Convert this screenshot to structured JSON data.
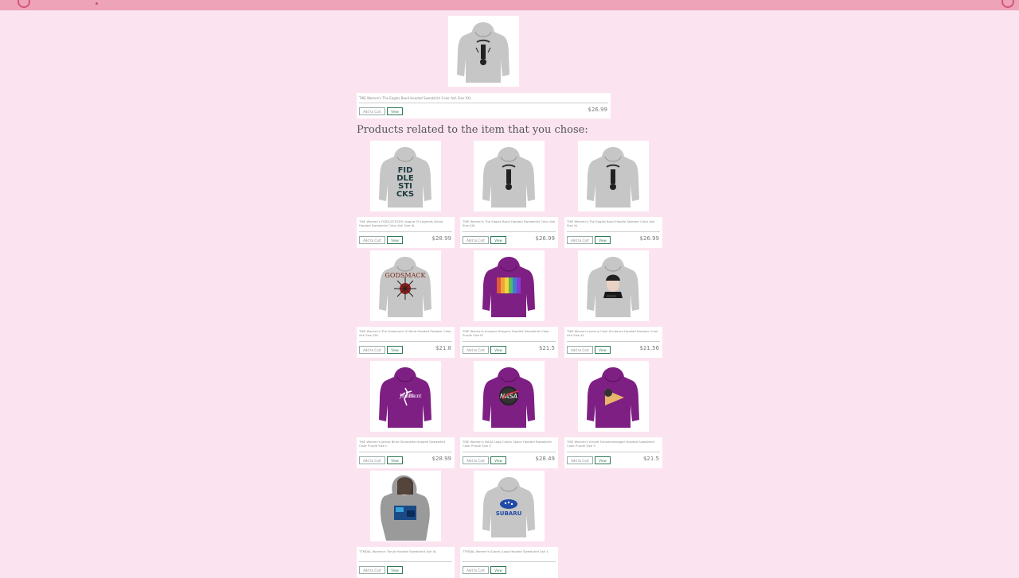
{
  "featured": {
    "image": "gray-hoodie-eagles-band",
    "title": "TIKE Women's The Eagles Band Hooded Sweatshirt Color Ash Size XXL",
    "add_label": "Add to Cart",
    "view_label": "View",
    "price": "$26.99"
  },
  "related_heading": "Products related to the item that you chose:",
  "products": [
    {
      "image": "gray-hoodie-fiddlesticks",
      "title": "TIKE Women's FIDDLESTICKS League Of Legends Afraid Hooded Sweatshirt Color Ash Size XL",
      "add_label": "Add to Cart",
      "view_label": "View",
      "price": "$28.99"
    },
    {
      "image": "gray-hoodie-eagles-band",
      "title": "TIKE Women's The Eagles Band Hooded Sweatshirt Color Ash Size XXL",
      "add_label": "Add to Cart",
      "view_label": "View",
      "price": "$26.99"
    },
    {
      "image": "gray-hoodie-eagles-band",
      "title": "TIKE Women's The Eagles Band Hoodie Sweater Color Ash Size XL",
      "add_label": "Add to Cart",
      "view_label": "View",
      "price": "$26.99"
    },
    {
      "image": "gray-hoodie-godsmack",
      "title": "TIKE Women's The Godsmack IV Band Hooded Sweater Color Ash Size XXL",
      "add_label": "Add to Cart",
      "view_label": "View",
      "price": "$21.8"
    },
    {
      "image": "purple-hoodie-imagine-dragons",
      "title": "TIKE Women's Imagine Dragons Hooded Sweatshirt Color Purple Size M",
      "add_label": "Add to Cart",
      "view_label": "View",
      "price": "$21.5"
    },
    {
      "image": "gray-hoodie-johnny-cash",
      "title": "TIKE Women's Johnny Cash Sculpture Hooded Sweater Color Ash Size XL",
      "add_label": "Add to Cart",
      "view_label": "View",
      "price": "$21.56"
    },
    {
      "image": "purple-hoodie-james-blunt",
      "title": "TIKE Women's James Blunt Silhouette Hooded Sweatshirt Color Purple Size L",
      "add_label": "Add to Cart",
      "view_label": "View",
      "price": "$28.99"
    },
    {
      "image": "purple-hoodie-nasa",
      "title": "TIKE Women's NASA Logo Colors Space Hooded Sweatshirt Color Purple Size S",
      "add_label": "Add to Cart",
      "view_label": "View",
      "price": "$28.49"
    },
    {
      "image": "purple-hoodie-arnold",
      "title": "TIKE Women's Arnold Schwarzenegger Hooded Sweatshirt Color Purple Size S",
      "add_label": "Add to Cart",
      "view_label": "View",
      "price": "$21.5"
    },
    {
      "image": "gray-zip-hoodie-tonuk",
      "title": "TTMDAL Women's Tonuk Hooded Sweatshirt Ash XL",
      "add_label": "Add to Cart",
      "view_label": "View",
      "price": ""
    },
    {
      "image": "gray-hoodie-subaru",
      "title": "TTMDAL Women's Subaru Logo Hooded Sweatshirt Ash L",
      "add_label": "Add to Cart",
      "view_label": "View",
      "price": ""
    }
  ]
}
